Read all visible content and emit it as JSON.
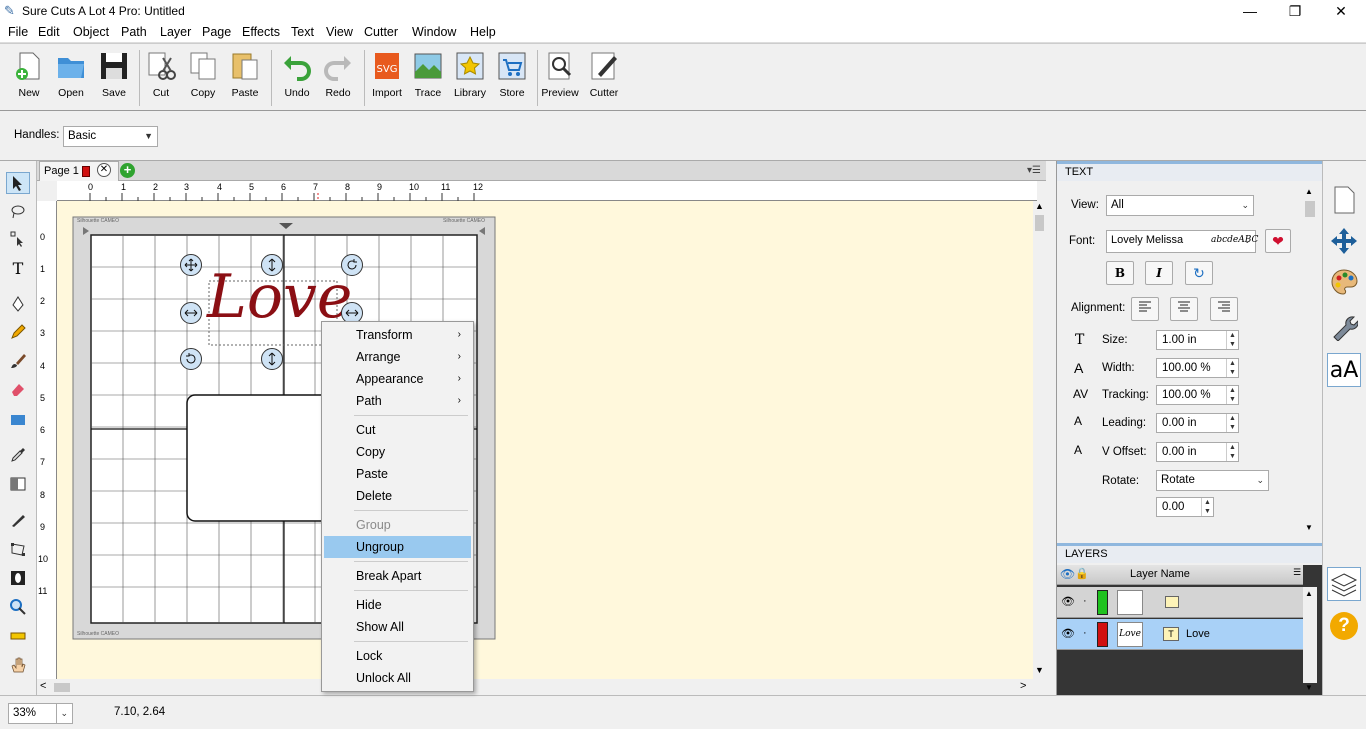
{
  "window": {
    "title": "Sure Cuts A Lot 4 Pro: Untitled"
  },
  "menubar": [
    "File",
    "Edit",
    "Object",
    "Path",
    "Layer",
    "Page",
    "Effects",
    "Text",
    "View",
    "Cutter",
    "Window",
    "Help"
  ],
  "toolbar": [
    {
      "label": "New",
      "icon": "new-icon"
    },
    {
      "label": "Open",
      "icon": "open-icon"
    },
    {
      "label": "Save",
      "icon": "save-icon"
    },
    {
      "label": "Cut",
      "icon": "cut-icon"
    },
    {
      "label": "Copy",
      "icon": "copy-icon"
    },
    {
      "label": "Paste",
      "icon": "paste-icon"
    },
    {
      "label": "Undo",
      "icon": "undo-icon"
    },
    {
      "label": "Redo",
      "icon": "redo-icon"
    },
    {
      "label": "Import",
      "icon": "import-icon"
    },
    {
      "label": "Trace",
      "icon": "trace-icon"
    },
    {
      "label": "Library",
      "icon": "library-icon"
    },
    {
      "label": "Store",
      "icon": "store-icon"
    },
    {
      "label": "Preview",
      "icon": "preview-icon"
    },
    {
      "label": "Cutter",
      "icon": "cutter-icon"
    }
  ],
  "handles": {
    "label": "Handles:",
    "value": "Basic"
  },
  "page_tab": {
    "label": "Page 1"
  },
  "ruler": {
    "h": [
      "0",
      "1",
      "2",
      "3",
      "4",
      "5",
      "6",
      "7",
      "8",
      "9",
      "10",
      "11",
      "12"
    ],
    "v": [
      "0",
      "1",
      "2",
      "3",
      "4",
      "5",
      "6",
      "7",
      "8",
      "9",
      "10",
      "11"
    ]
  },
  "mat": {
    "brand": "Silhouette CAMEO"
  },
  "canvas_text": {
    "word": "Love"
  },
  "context_menu": {
    "items": [
      {
        "label": "Transform",
        "submenu": true
      },
      {
        "label": "Arrange",
        "submenu": true
      },
      {
        "label": "Appearance",
        "submenu": true
      },
      {
        "label": "Path",
        "submenu": true
      },
      {
        "sep": true
      },
      {
        "label": "Cut"
      },
      {
        "label": "Copy"
      },
      {
        "label": "Paste"
      },
      {
        "label": "Delete"
      },
      {
        "sep": true
      },
      {
        "label": "Group",
        "disabled": true
      },
      {
        "label": "Ungroup",
        "highlighted": true
      },
      {
        "sep": true
      },
      {
        "label": "Break Apart"
      },
      {
        "sep": true
      },
      {
        "label": "Hide"
      },
      {
        "label": "Show All"
      },
      {
        "sep": true
      },
      {
        "label": "Lock"
      },
      {
        "label": "Unlock All"
      }
    ]
  },
  "text_panel": {
    "title": "TEXT",
    "view_label": "View:",
    "view_value": "All",
    "font_label": "Font:",
    "font_value": "Lovely Melissa",
    "font_sample": "abcdeABC",
    "bold": "B",
    "italic": "I",
    "alignment_label": "Alignment:",
    "size_label": "Size:",
    "size_value": "1.00 in",
    "width_label": "Width:",
    "width_value": "100.00 %",
    "tracking_label": "Tracking:",
    "tracking_value": "100.00 %",
    "leading_label": "Leading:",
    "leading_value": "0.00 in",
    "voffset_label": "V Offset:",
    "voffset_value": "0.00 in",
    "rotate_label": "Rotate:",
    "rotate_value": "Rotate",
    "rotate_amount": "0.00"
  },
  "layers_panel": {
    "title": "LAYERS",
    "column": "Layer Name",
    "rows": [
      {
        "name": "",
        "color": "#1fc21f"
      },
      {
        "name": "Love",
        "color": "#d01010",
        "selected": true
      }
    ]
  },
  "status": {
    "zoom": "33%",
    "coords": "7.10, 2.64"
  },
  "colors": {
    "accent": "#99c9ef",
    "canvas": "#fff8dc",
    "text_red": "#8b0f14"
  }
}
